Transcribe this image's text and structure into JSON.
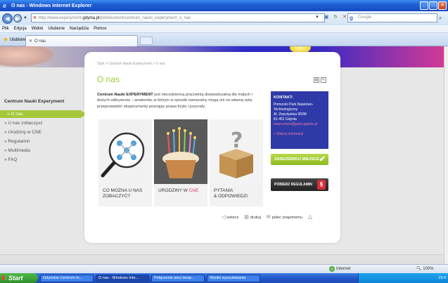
{
  "window": {
    "title": "O nas - Windows Internet Explorer"
  },
  "address": {
    "url_prefix": "http://www.experyment.",
    "url_domain": "gdynia.pl",
    "url_path": "/pl/dokument/centrum_nauki_experyment_o_nas",
    "search_placeholder": "Google"
  },
  "menu": [
    "Plik",
    "Edycja",
    "Widok",
    "Ulubione",
    "Narzędzia",
    "Pomoc"
  ],
  "favorites": {
    "label": "Ulubione",
    "tab_title": "O nas"
  },
  "sidebar": {
    "title": "Centrum Nauki Experyment",
    "items": [
      {
        "label": "» O nas"
      },
      {
        "label": "» U nas zobaczysz"
      },
      {
        "label": "» Urodziny w CNE"
      },
      {
        "label": "» Regulamin"
      },
      {
        "label": "» Multimedia"
      },
      {
        "label": "» FAQ"
      }
    ]
  },
  "content": {
    "breadcrumb": "Start > Centrum Nauki Experyment > O nas",
    "title": "O nas",
    "intro_bold": "Centrum Nauki EXPERYMENT",
    "intro_rest": " jest niecodzienną pracownią doświadczalną dla małych i dużych odkrywców – amatorów, w którym w sposób namacalny mogą oni na własną rękę przeprowadzić eksperymenty poznając prawa fizyki i przyrody."
  },
  "contact": {
    "heading": "KONTAKT:",
    "line1": "Pomorski Park Naukowo-",
    "line2": "Technologiczny",
    "line3": "Al. Zwycięstwa 96/98",
    "line4": "81-451 Gdynia",
    "email": "experyment@ppnt.gdynia.pl",
    "more": "» Więcej informacji"
  },
  "buttons": {
    "reserve": "ZAREZERWUJ MIEJSCE",
    "rules": "POBIERZ REGULAMIN"
  },
  "tiles": [
    {
      "line1": "CO MOŻNA U NAS",
      "line2": "ZOBACZYĆ?"
    },
    {
      "line1": "URODZINY W ",
      "highlight": "CNE"
    },
    {
      "line1": "PYTANIA",
      "line2": "& ODPOWIEDZI"
    }
  ],
  "actions": {
    "back": "wstecz",
    "print": "drukuj",
    "recommend": "poleć znajomemu"
  },
  "statusbar": {
    "zone": "Internet",
    "zoom": "100%"
  },
  "taskbar": {
    "start": "Start",
    "tasks": [
      "Gdyńskie Centrum In...",
      "O nas - Windows Inte...",
      "Połączenie sieci bezp...",
      "Wyniki wyszukiwania"
    ],
    "clock": "15:4"
  }
}
